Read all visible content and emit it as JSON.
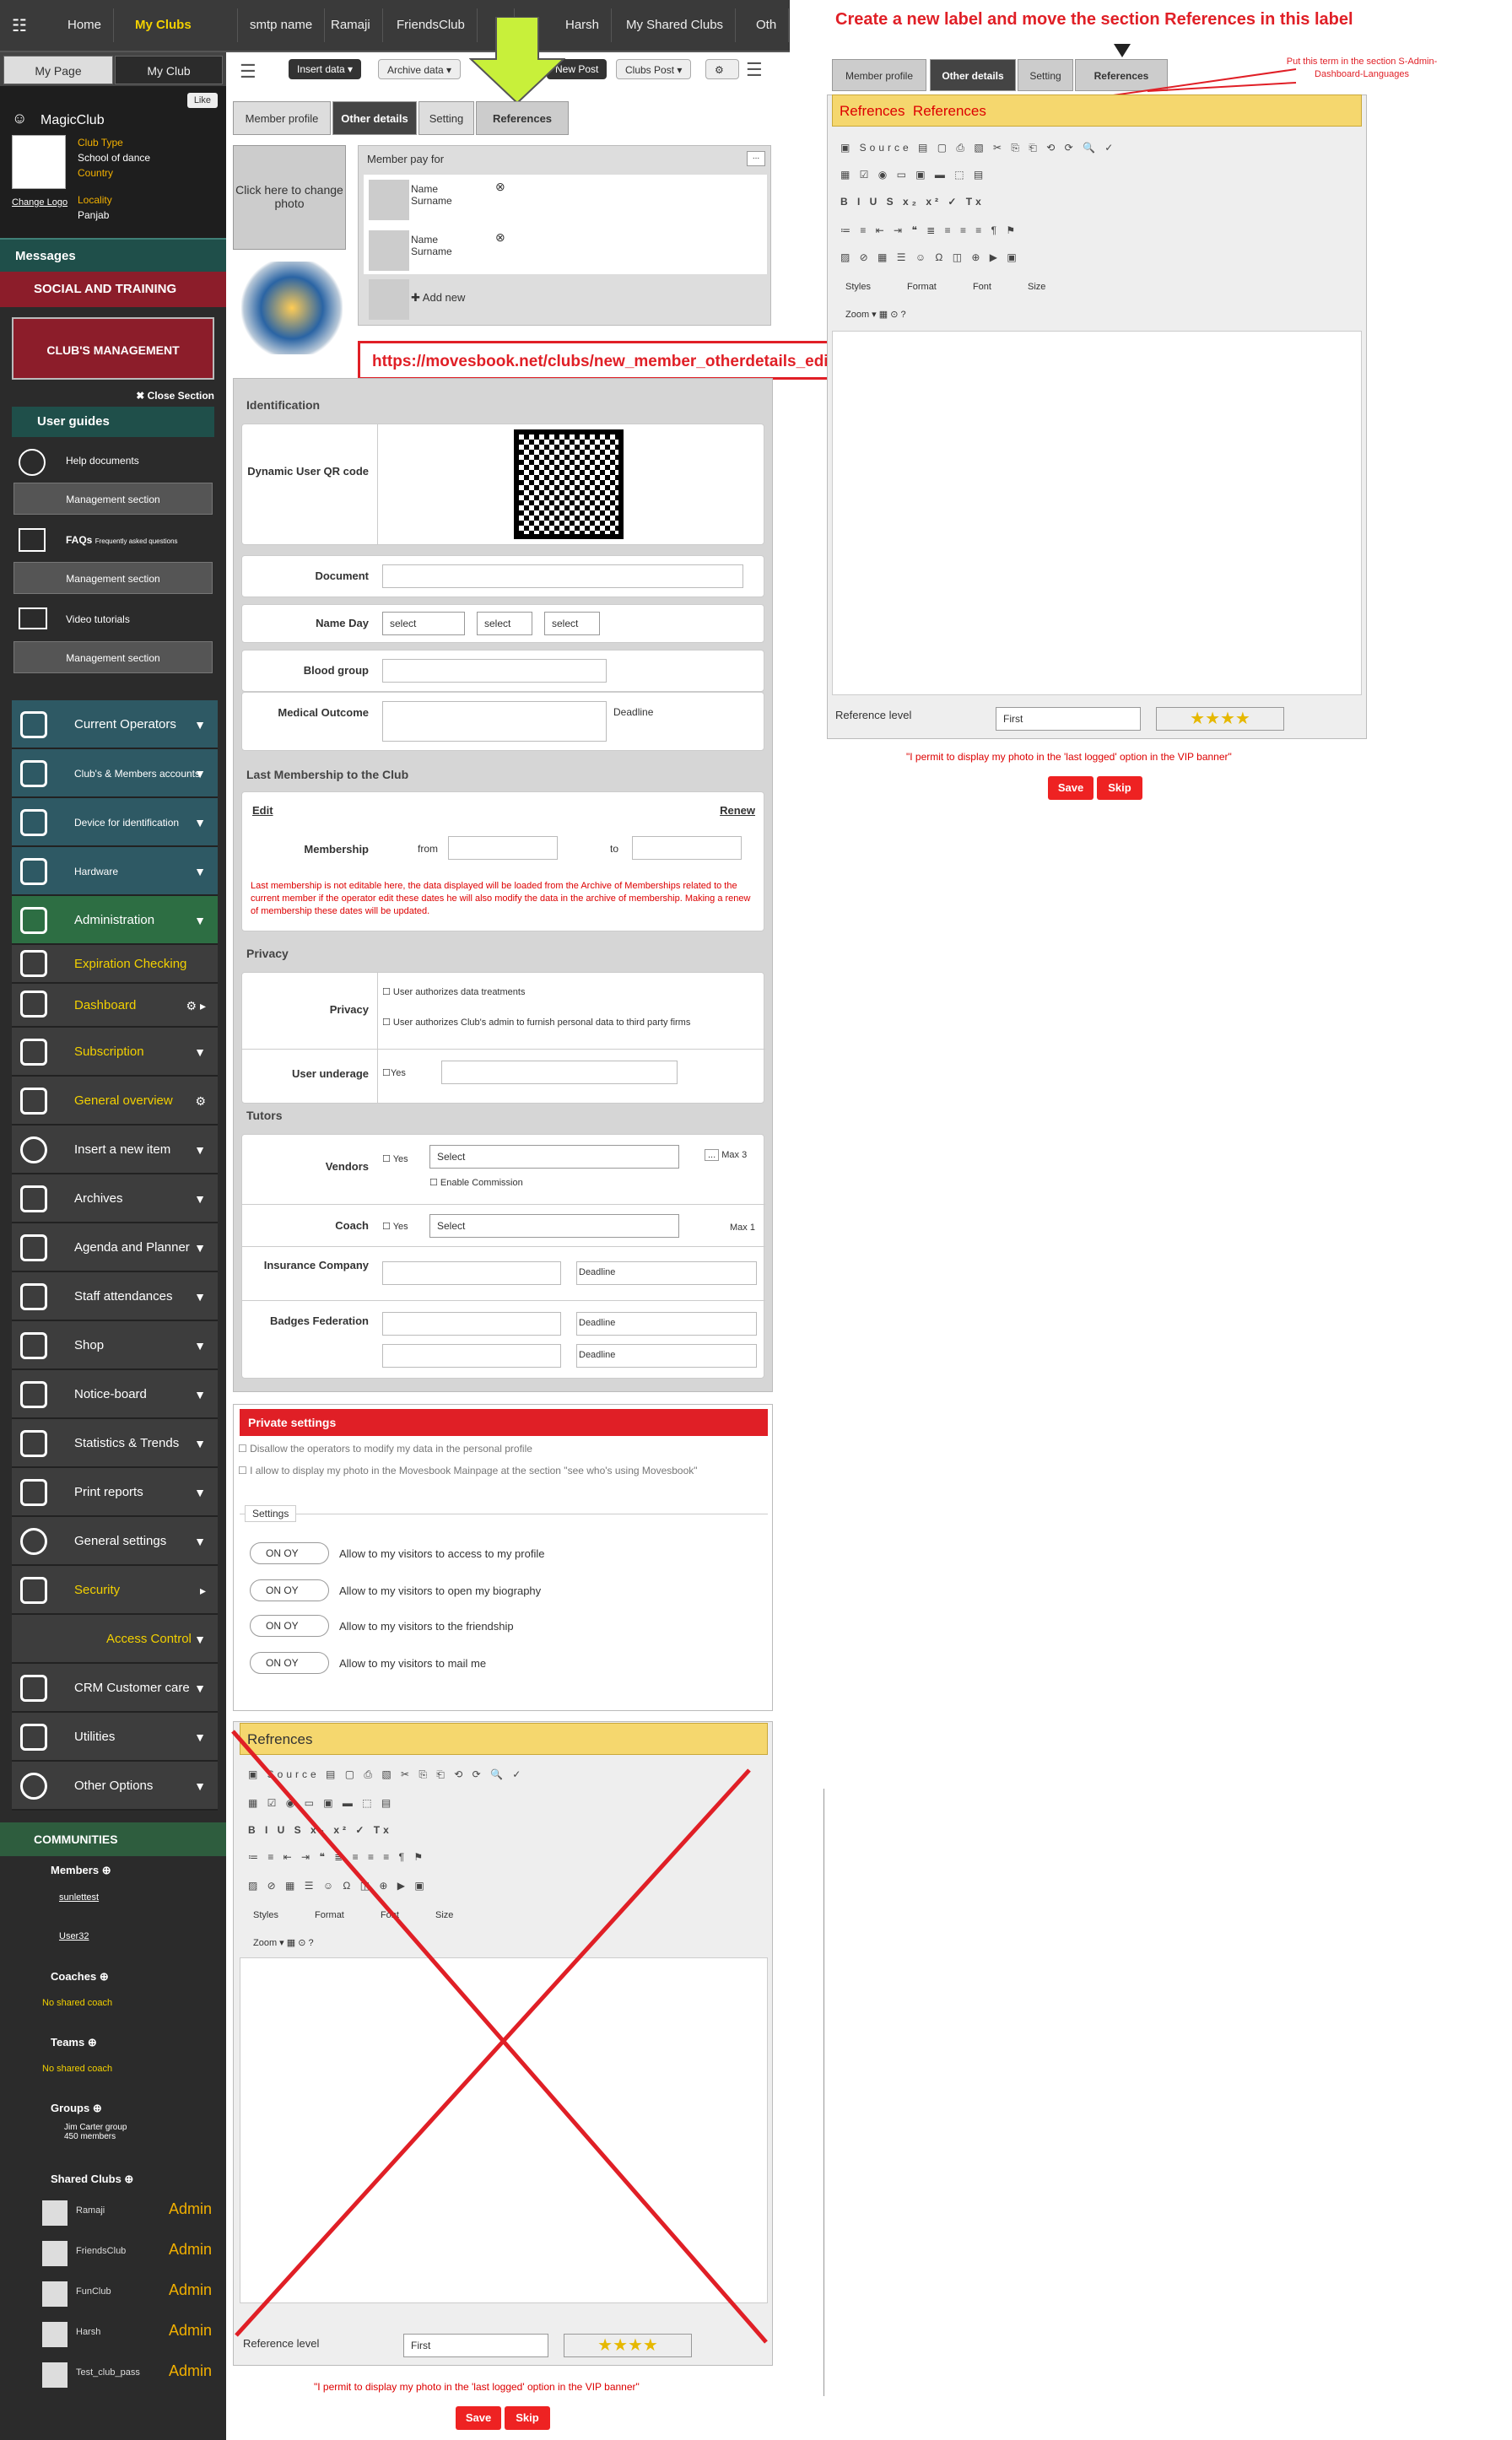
{
  "topnav": {
    "items": [
      "Home",
      "My Clubs",
      "smtp name",
      "Ramaji",
      "FriendsClub",
      "F",
      "Harsh",
      "My Shared Clubs",
      "Oth"
    ]
  },
  "sidebar": {
    "tabs": [
      "My Page",
      "My Club"
    ],
    "like": "Like",
    "club_name": "MagicClub",
    "club_type": "Club Type",
    "school": "School of dance",
    "country": "Country",
    "locality": "Locality",
    "region": "Panjab",
    "change_logo": "Change Logo",
    "messages": "Messages",
    "social": "SOCIAL AND TRAINING",
    "clubs_mgmt": "CLUB'S MANAGEMENT",
    "close_section": "✖ Close Section",
    "user_guides": "User guides",
    "help_docs": "Help documents",
    "faqs": "FAQs",
    "faqs_sub": "Frequently asked questions",
    "video": "Video tutorials",
    "mgmt": "Management section",
    "menus": [
      "Current Operators",
      "Club's & Members accounts",
      "Device for identification",
      "Hardware",
      "Administration",
      "Expiration Checking",
      "Dashboard",
      "Subscription",
      "General overview",
      "Insert a new item",
      "Archives",
      "Agenda and Planner",
      "Staff attendances",
      "Shop",
      "Notice-board",
      "Statistics & Trends",
      "Print reports",
      "General settings",
      "Security",
      "Access Control",
      "CRM Customer care",
      "Utilities",
      "Other Options"
    ],
    "communities": "COMMUNITIES",
    "members": "Members",
    "member_names": [
      "sunlettest",
      "User32"
    ],
    "coaches": "Coaches",
    "teams": "Teams",
    "no_coach": "No shared coach",
    "groups": "Groups",
    "group_name": "Jim Carter group",
    "group_members": "450 members",
    "shared_clubs": "Shared Clubs",
    "admin": "Admin",
    "shared_names": [
      "Ramaji",
      "FriendsClub",
      "FunClub",
      "Harsh",
      "Test_club_pass"
    ]
  },
  "toolbar": {
    "insert": "Insert data ▾",
    "archive": "Archive data ▾",
    "post": "New Post",
    "clubs_post": "Clubs Post ▾"
  },
  "tabs": [
    "Member profile",
    "Other details",
    "Setting",
    "References"
  ],
  "photo": {
    "label": "Click here to change photo"
  },
  "member_pay": {
    "title": "Member pay for",
    "name": "Name",
    "surname": "Surname",
    "add": "✚ Add new",
    "more": "..."
  },
  "url": "https://movesbook.net/clubs/new_member_otherdetails_edit/1584#",
  "identification": {
    "title": "Identification",
    "qr": "Dynamic User QR code",
    "document": "Document",
    "name_day": "Name Day",
    "select": "select",
    "blood": "Blood group",
    "medical": "Medical Outcome",
    "deadline": "Deadline"
  },
  "membership": {
    "title": "Last Membership to the Club",
    "edit": "Edit",
    "renew": "Renew",
    "label": "Membership",
    "from": "from",
    "to": "to",
    "note": "Last membership is not editable here, the data displayed will be loaded from the Archive of Memberships related to the current member if the operator edit these dates he will also modify the data in the archive of membership. Making a renew of membership these dates will be updated."
  },
  "privacy": {
    "title": "Privacy",
    "label": "Privacy",
    "opt1": "User authorizes data treatments",
    "opt2": "User authorizes Club's admin to furnish personal data to third party firms",
    "underage": "User underage",
    "yes": "Yes"
  },
  "tutors": {
    "title": "Tutors",
    "vendors": "Vendors",
    "yes": "Yes",
    "select": "Select",
    "commission": "Enable Commission",
    "max3": "Max 3",
    "coach": "Coach",
    "max1": "Max 1",
    "insurance": "Insurance Company",
    "deadline": "Deadline",
    "badges": "Badges Federation",
    "dots": "..."
  },
  "private": {
    "title": "Private settings",
    "opt1": "Disallow the operators to modify my data in the personal profile",
    "opt2": "I allow to display my photo in the Movesbook Mainpage at the section \"see who's using Movesbook\"",
    "settings": "Settings",
    "toggle": "ON  OY",
    "rows": [
      "Allow to my visitors to access to my profile",
      "Allow to my visitors to open my biography",
      "Allow to my visitors to the friendship",
      "Allow to my visitors to mail me"
    ]
  },
  "references": {
    "title": "Refrences",
    "title_right": "Refrences  References",
    "source": "Source",
    "styles": "Styles",
    "format": "Format",
    "font": "Font",
    "size": "Size",
    "zoom": "Zoom",
    "level": "Reference level",
    "first": "First",
    "stars": "★★★★",
    "permit": "\"I permit to display my photo in the 'last logged' option in the VIP banner\"",
    "save": "Save",
    "skip": "Skip"
  },
  "annotation": {
    "title": "Create a new label and move the section References in this label",
    "note": "Put this term in the section S-Admin-Dashboard-Languages"
  },
  "colors": {
    "red": "#e01f26",
    "yellow": "#f5d76e",
    "arrow": "#c8f03a"
  }
}
